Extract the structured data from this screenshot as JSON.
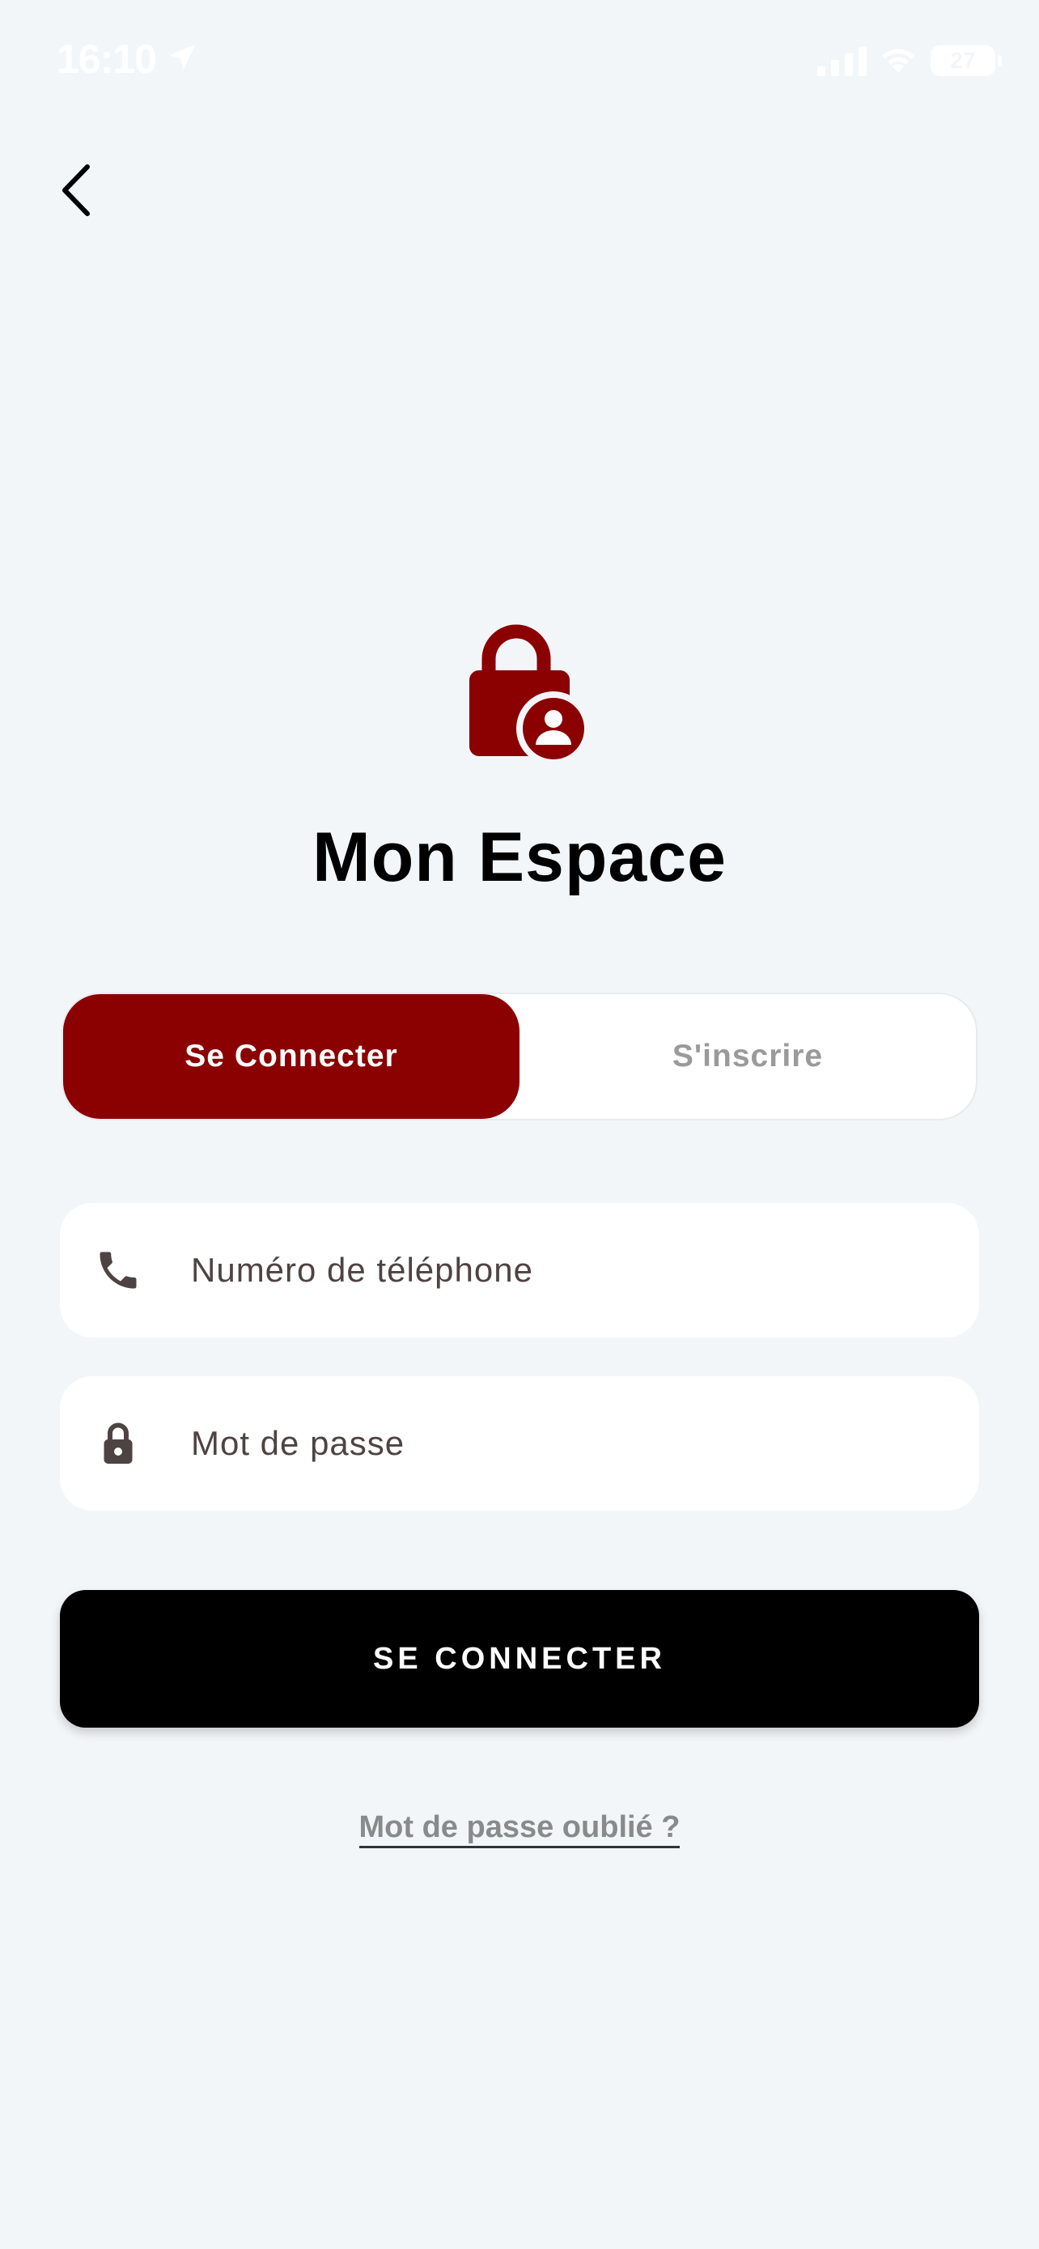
{
  "status_bar": {
    "time": "16:10",
    "battery": "27"
  },
  "header": {
    "back_icon": "chevron-left-icon"
  },
  "logo": {
    "icon": "lock-user-icon",
    "color": "#8b0000"
  },
  "page": {
    "title": "Mon Espace"
  },
  "tabs": [
    {
      "label": "Se Connecter",
      "active": true
    },
    {
      "label": "S'inscrire",
      "active": false
    }
  ],
  "form": {
    "phone": {
      "placeholder": "Numéro de téléphone",
      "value": "",
      "icon": "phone-icon"
    },
    "password": {
      "placeholder": "Mot de passe",
      "value": "",
      "icon": "lock-icon"
    },
    "submit_label": "SE CONNECTER",
    "forgot_label": "Mot de passe oublié ?"
  },
  "colors": {
    "accent": "#8b0000",
    "background": "#f3f6f9",
    "primary_button": "#000000"
  }
}
